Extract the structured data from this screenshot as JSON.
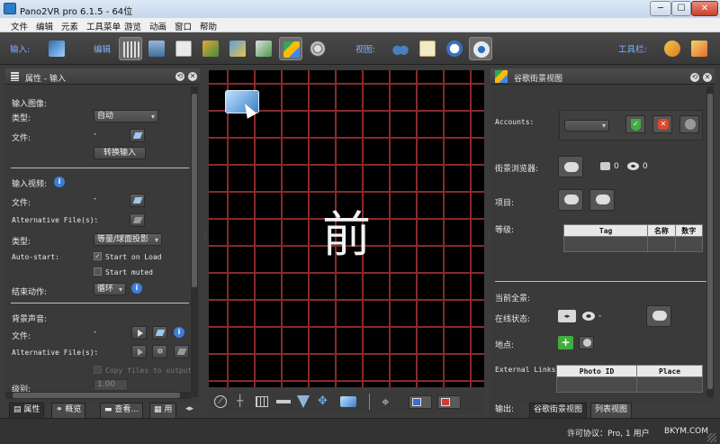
{
  "window": {
    "title": "Pano2VR pro 6.1.5 - 64位",
    "minimize": "─",
    "maximize": "☐",
    "close": "✕"
  },
  "menu": [
    "文件",
    "编辑",
    "元素",
    "工具菜单",
    "游览",
    "动画",
    "窗口",
    "帮助"
  ],
  "toolbar": {
    "input_label": "输入:",
    "edit_label": "编辑",
    "view_label": "视图:",
    "toolbars_label": "工具栏:"
  },
  "left_panel": {
    "title": "属性 - 输入",
    "input_image": {
      "section": "输入图像:",
      "type_label": "类型:",
      "type_value": "自动",
      "file_label": "文件:",
      "file_value": "-",
      "convert_button": "转换输入"
    },
    "input_video": {
      "section": "输入视频:",
      "file_label": "文件:",
      "file_value": "-",
      "alt_label": "Alternative File(s):",
      "alt_value": "-",
      "type_label": "类型:",
      "type_value": "等量/球面投影",
      "autostart_label": "Auto-start:",
      "start_on_load": "Start on Load",
      "start_muted": "Start muted",
      "end_action_label": "结束动作:",
      "end_action_value": "循环"
    },
    "bg_sound": {
      "section": "背景声音:",
      "file_label": "文件:",
      "file_value": "-",
      "alt_label": "Alternative File(s):",
      "alt_value": "-",
      "copy_files": "Copy files to output",
      "level_label": "级别:",
      "level_value": "1.00"
    },
    "tabs": [
      "属性",
      "概览",
      "查看…",
      "用"
    ]
  },
  "viewport": {
    "front_label": "前"
  },
  "right_panel": {
    "title": "谷歌街景视图",
    "accounts_label": "Accounts:",
    "browser_label": "街景浏览器:",
    "photo_count": "0",
    "view_count": "0",
    "project_label": "项目:",
    "level_label": "等级:",
    "level_table": {
      "headers": [
        "Tag",
        "名称",
        "数字"
      ]
    },
    "current_pano": "当前全景:",
    "online_status_label": "在线状态:",
    "online_status_value": "-",
    "location_label": "地点:",
    "external_links_label": "External Links:",
    "links_table": {
      "headers": [
        "Photo ID",
        "Place"
      ]
    },
    "tabs": [
      "输出:",
      "谷歌街景视图",
      "列表视图"
    ]
  },
  "status": {
    "license": "许可协议：Pro, 1 用户",
    "watermark": "BKYM.COM"
  },
  "colors": {
    "accent_blue": "#7fb3ff",
    "grid_red": "#8a2a2a",
    "panel_bg": "#3a3a3a"
  }
}
